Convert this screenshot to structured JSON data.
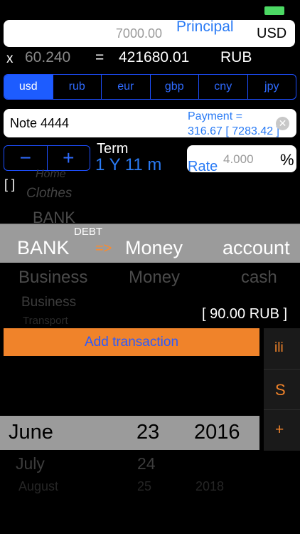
{
  "principal": {
    "value": "7000.00",
    "label": "Principal",
    "currency": "USD"
  },
  "conversion": {
    "x_sign": "x",
    "rate": "60.240",
    "equals": "=",
    "result": "421680.01",
    "result_currency": "RUB"
  },
  "currencies": {
    "items": [
      "usd",
      "rub",
      "eur",
      "gbp",
      "cny",
      "jpy"
    ],
    "selected": "usd"
  },
  "note": {
    "value": "Note 4444"
  },
  "payment": {
    "line1": "Payment =",
    "line2": "316.67 [ 7283.42 ]"
  },
  "term": {
    "minus": "−",
    "plus": "+",
    "label": "Term",
    "value": "1 Y  11 m"
  },
  "rate": {
    "label": "Rate",
    "value": "4.000",
    "unit": "%"
  },
  "brackets": "[ ]",
  "category_picker": {
    "above": [
      "Home",
      "Clothes",
      "BANK"
    ],
    "debt_label": "DEBT",
    "selected_from": "BANK",
    "arrow": "=>",
    "selected_to": "Money",
    "selected_account": "account",
    "below_row1": [
      "Business",
      "Money",
      "cash"
    ],
    "below_row2": "Business",
    "below_row3": "Transport"
  },
  "balance": "[ 90.00 RUB ]",
  "add_transaction_label": "Add transaction",
  "side_buttons": {
    "list": "ili",
    "sum": "S",
    "add": "+"
  },
  "date_picker": {
    "month": "June",
    "day": "23",
    "year": "2016",
    "next_month": "July",
    "next_day": "24",
    "next2_month": "August",
    "next2_day": "25",
    "next2_year": "2018"
  },
  "colors": {
    "accent_blue": "#2a7bf5",
    "orange": "#f0832a",
    "battery_green": "#4cd964"
  }
}
